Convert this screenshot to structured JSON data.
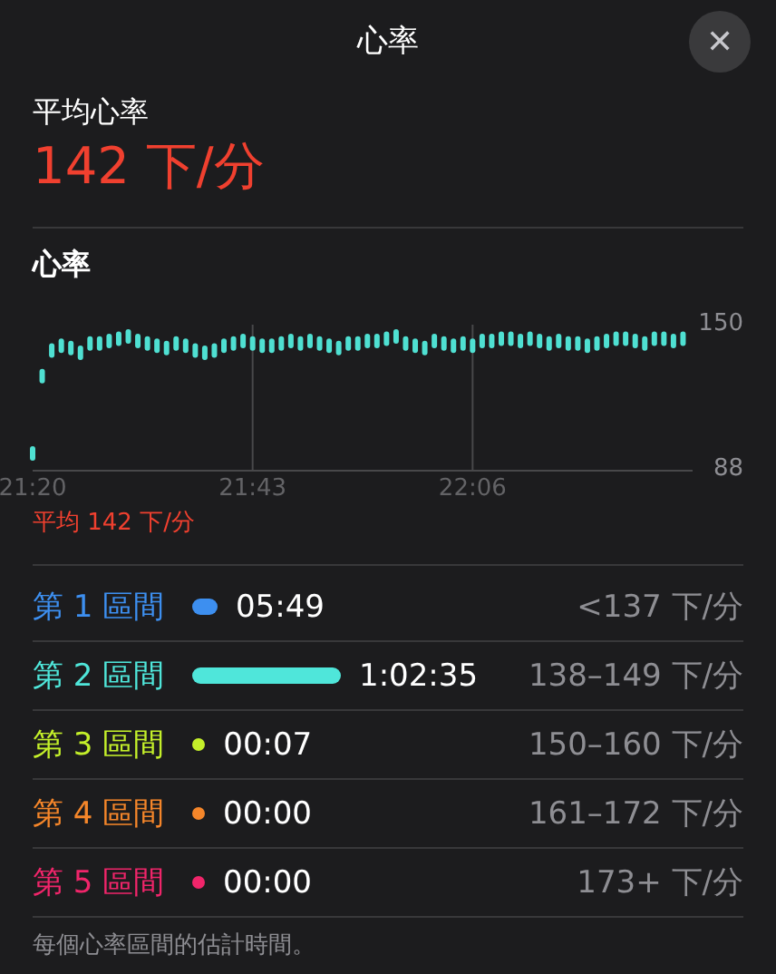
{
  "header": {
    "title": "心率",
    "close": "✕"
  },
  "average": {
    "label": "平均心率",
    "value": "142 下/分"
  },
  "heart_rate": {
    "title": "心率",
    "average_note": "平均 142 下/分",
    "chart_data": {
      "type": "scatter",
      "xlim": [
        1280,
        1349
      ],
      "ylim": [
        88,
        150
      ],
      "yticks": [
        88,
        150
      ],
      "xticks": [
        {
          "value": 1280,
          "label": "21:20"
        },
        {
          "value": 1303,
          "label": "21:43"
        },
        {
          "value": 1326,
          "label": "22:06"
        }
      ],
      "x": [
        1280,
        1281,
        1282,
        1283,
        1284,
        1285,
        1286,
        1287,
        1288,
        1289,
        1290,
        1291,
        1292,
        1293,
        1294,
        1295,
        1296,
        1297,
        1298,
        1299,
        1300,
        1301,
        1302,
        1303,
        1304,
        1305,
        1306,
        1307,
        1308,
        1309,
        1310,
        1311,
        1312,
        1313,
        1314,
        1315,
        1316,
        1317,
        1318,
        1319,
        1320,
        1321,
        1322,
        1323,
        1324,
        1325,
        1326,
        1327,
        1328,
        1329,
        1330,
        1331,
        1332,
        1333,
        1334,
        1335,
        1336,
        1337,
        1338,
        1339,
        1340,
        1341,
        1342,
        1343,
        1344,
        1345,
        1346,
        1347,
        1348
      ],
      "series": [
        {
          "color": "#4fe0d2",
          "values": [
            95,
            128,
            139,
            141,
            140,
            138,
            142,
            142,
            143,
            144,
            145,
            143,
            142,
            141,
            140,
            142,
            141,
            139,
            138,
            139,
            141,
            142,
            143,
            142,
            141,
            141,
            142,
            143,
            142,
            143,
            142,
            141,
            140,
            142,
            142,
            143,
            143,
            144,
            145,
            142,
            141,
            140,
            143,
            142,
            141,
            142,
            141,
            143,
            143,
            144,
            144,
            143,
            144,
            143,
            142,
            143,
            142,
            142,
            141,
            142,
            143,
            144,
            144,
            143,
            142,
            144,
            144,
            143,
            144
          ]
        }
      ]
    }
  },
  "zones": [
    {
      "label": "第 1 區間",
      "color": "#3d8ff0",
      "time": "05:49",
      "range": "<137 下/分"
    },
    {
      "label": "第 2 區間",
      "color": "#4fe6da",
      "time": "1:02:35",
      "range": "138–149 下/分"
    },
    {
      "label": "第 3 區間",
      "color": "#c4f02a",
      "time": "00:07",
      "range": "150–160 下/分"
    },
    {
      "label": "第 4 區間",
      "color": "#f5862a",
      "time": "00:00",
      "range": "161–172 下/分"
    },
    {
      "label": "第 5 區間",
      "color": "#f0256a",
      "time": "00:00",
      "range": "173+ 下/分"
    }
  ],
  "footnote": "每個心率區間的估計時間。"
}
